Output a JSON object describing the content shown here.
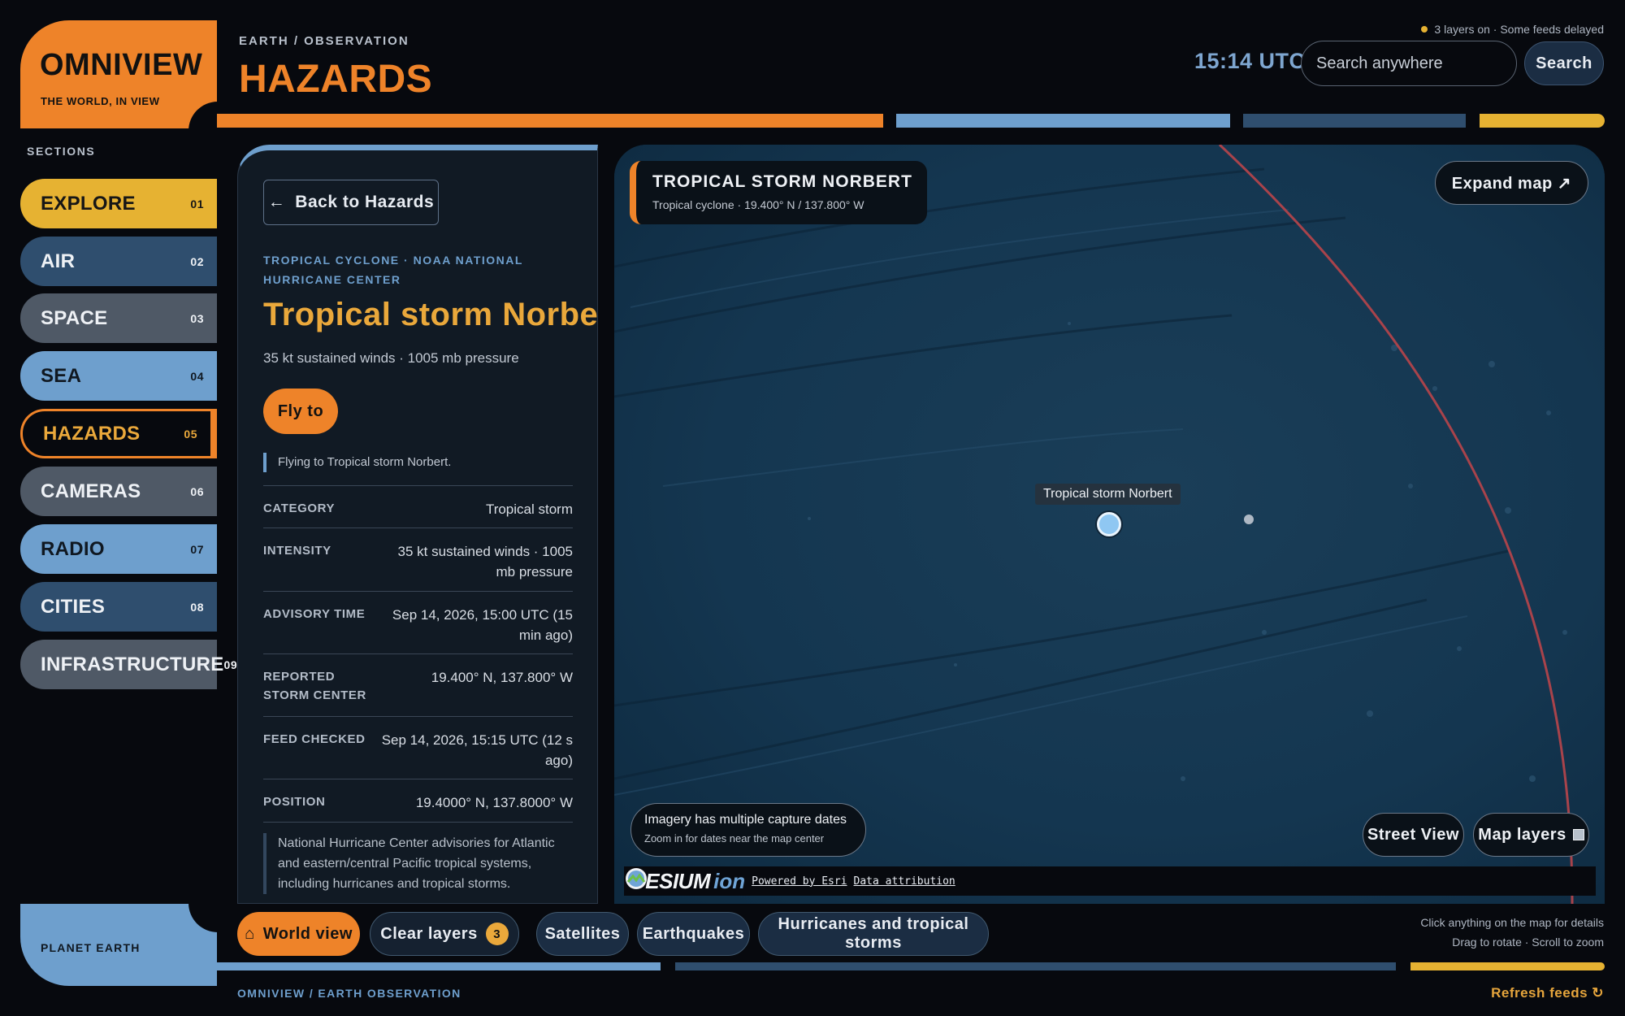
{
  "brand": {
    "name": "OMNIVIEW",
    "tagline": "THE WORLD, IN VIEW"
  },
  "header": {
    "breadcrumb": "EARTH / OBSERVATION",
    "title": "HAZARDS",
    "status": "3 layers on · Some feeds delayed",
    "clock": "15:14 UTC",
    "search_placeholder": "Search anywhere",
    "search_button": "Search"
  },
  "colors": {
    "accent": "#ee8329",
    "gold": "#e6b232",
    "blue": "#6e9fcd",
    "navy": "#2f4e6e",
    "slate": "#4f5966",
    "dark_bg": "#07090e"
  },
  "sidebar": {
    "label": "SECTIONS",
    "items": [
      {
        "label": "EXPLORE",
        "num": "01"
      },
      {
        "label": "AIR",
        "num": "02"
      },
      {
        "label": "SPACE",
        "num": "03"
      },
      {
        "label": "SEA",
        "num": "04"
      },
      {
        "label": "HAZARDS",
        "num": "05"
      },
      {
        "label": "CAMERAS",
        "num": "06"
      },
      {
        "label": "RADIO",
        "num": "07"
      },
      {
        "label": "CITIES",
        "num": "08"
      },
      {
        "label": "INFRASTRUCTURE",
        "num": "09"
      }
    ],
    "active": "HAZARDS",
    "planet": "PLANET EARTH"
  },
  "detail": {
    "back_button": "Back to Hazards",
    "back_icon": "arrow-left-icon",
    "kicker": "TROPICAL CYCLONE · NOAA NATIONAL HURRICANE CENTER",
    "title": "Tropical storm Norbert",
    "subtitle": "35 kt sustained winds · 1005 mb pressure",
    "fly_button": "Fly to",
    "fly_status": "Flying to Tropical storm Norbert.",
    "rows": [
      {
        "key": "CATEGORY",
        "value": "Tropical storm"
      },
      {
        "key": "INTENSITY",
        "value": "35 kt sustained winds · 1005 mb pressure"
      },
      {
        "key": "ADVISORY TIME",
        "value": "Sep 14, 2026, 15:00 UTC (15 min ago)"
      },
      {
        "key": "REPORTED STORM CENTER",
        "value": "19.400° N, 137.800° W"
      },
      {
        "key": "FEED CHECKED",
        "value": "Sep 14, 2026, 15:15 UTC (12 s ago)"
      },
      {
        "key": "POSITION",
        "value": "19.4000° N, 137.8000° W"
      }
    ],
    "description": "National Hurricane Center advisories for Atlantic and eastern/central Pacific tropical systems, including hurricanes and tropical storms."
  },
  "map": {
    "card_title": "TROPICAL STORM NORBERT",
    "card_sub": "Tropical cyclone · 19.400° N / 137.800° W",
    "expand_button": "Expand map ↗",
    "pin_label": "Tropical storm Norbert",
    "imagery_title": "Imagery has multiple capture dates",
    "imagery_sub": "Zoom in for dates near the map center",
    "street_view": "Street View",
    "map_layers": "Map layers",
    "cesium": "CESIUM",
    "ion": "ion",
    "powered": "Powered by Esri",
    "attribution": "Data attribution"
  },
  "chips": {
    "world_view": "World view",
    "world_icon": "⌂",
    "clear_layers": "Clear layers",
    "clear_count": "3",
    "satellites": "Satellites",
    "earthquakes": "Earthquakes",
    "hurricanes": "Hurricanes and tropical storms"
  },
  "hints": {
    "line1": "Click anything on the map for details",
    "line2": "Drag to rotate · Scroll to zoom"
  },
  "footer": {
    "breadcrumb": "OMNIVIEW / EARTH OBSERVATION",
    "refresh": "Refresh feeds ↻"
  }
}
